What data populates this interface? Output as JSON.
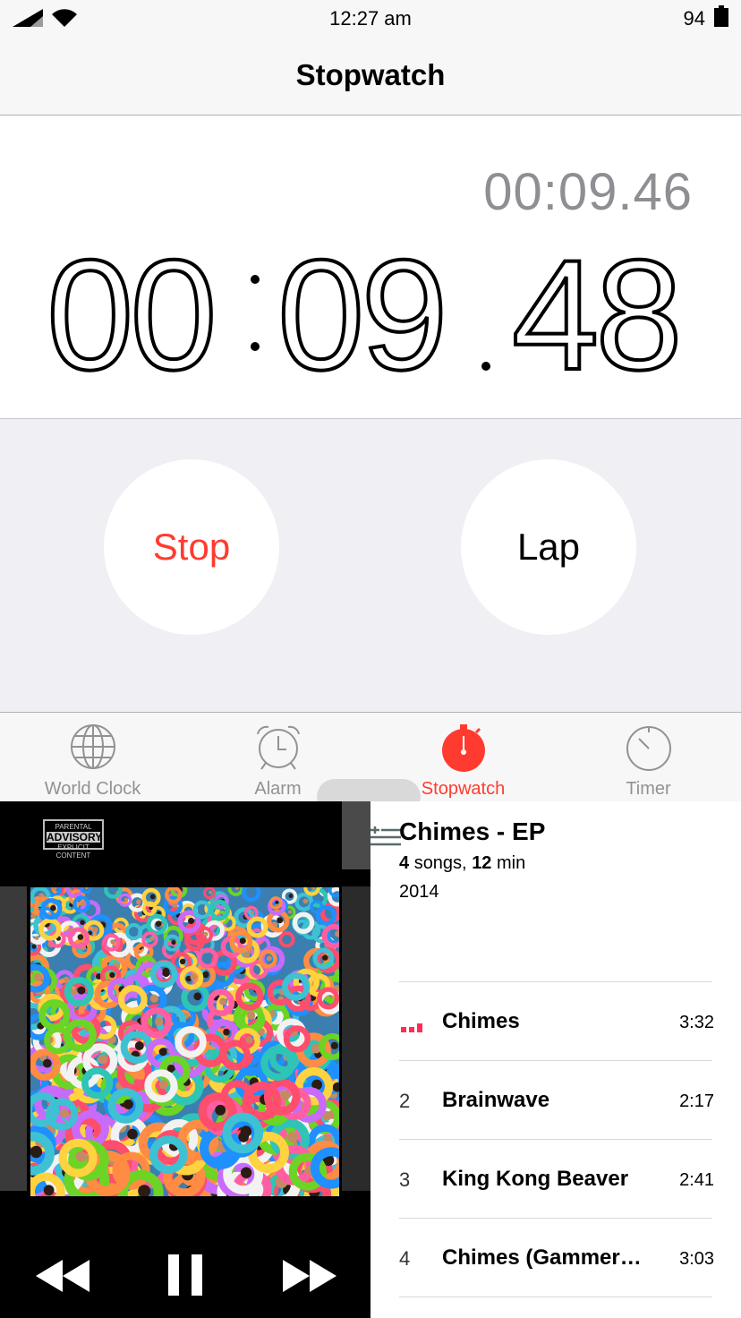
{
  "status_bar": {
    "time": "12:27 am",
    "battery_percent": "94"
  },
  "nav": {
    "title": "Stopwatch"
  },
  "stopwatch": {
    "lap_time": "00:09.46",
    "minutes": "00",
    "seconds": "09",
    "hundredths": "48",
    "stop_label": "Stop",
    "lap_label": "Lap"
  },
  "tabs": [
    {
      "label": "World Clock",
      "icon": "globe-icon"
    },
    {
      "label": "Alarm",
      "icon": "alarm-clock-icon"
    },
    {
      "label": "Stopwatch",
      "icon": "stopwatch-icon",
      "active": true
    },
    {
      "label": "Timer",
      "icon": "timer-icon"
    }
  ],
  "colors": {
    "accent": "#ff3b30",
    "inactive_tab": "#929292",
    "lap_time": "#8e8e93",
    "playing": "#ff2d55"
  },
  "music": {
    "advisory_top": "PARENTAL",
    "advisory_mid": "ADVISORY",
    "advisory_bottom": "EXPLICIT CONTENT",
    "album_title": "Chimes - EP",
    "song_count": "4",
    "songs_word": "songs,",
    "duration_min": "12",
    "min_word": "min",
    "year": "2014",
    "tracks": [
      {
        "number": "",
        "name": "Chimes",
        "duration": "3:32",
        "playing": true
      },
      {
        "number": "2",
        "name": "Brainwave",
        "duration": "2:17"
      },
      {
        "number": "3",
        "name": "King Kong Beaver",
        "duration": "2:41"
      },
      {
        "number": "4",
        "name": "Chimes (Gammer…",
        "duration": "3:03"
      }
    ]
  }
}
